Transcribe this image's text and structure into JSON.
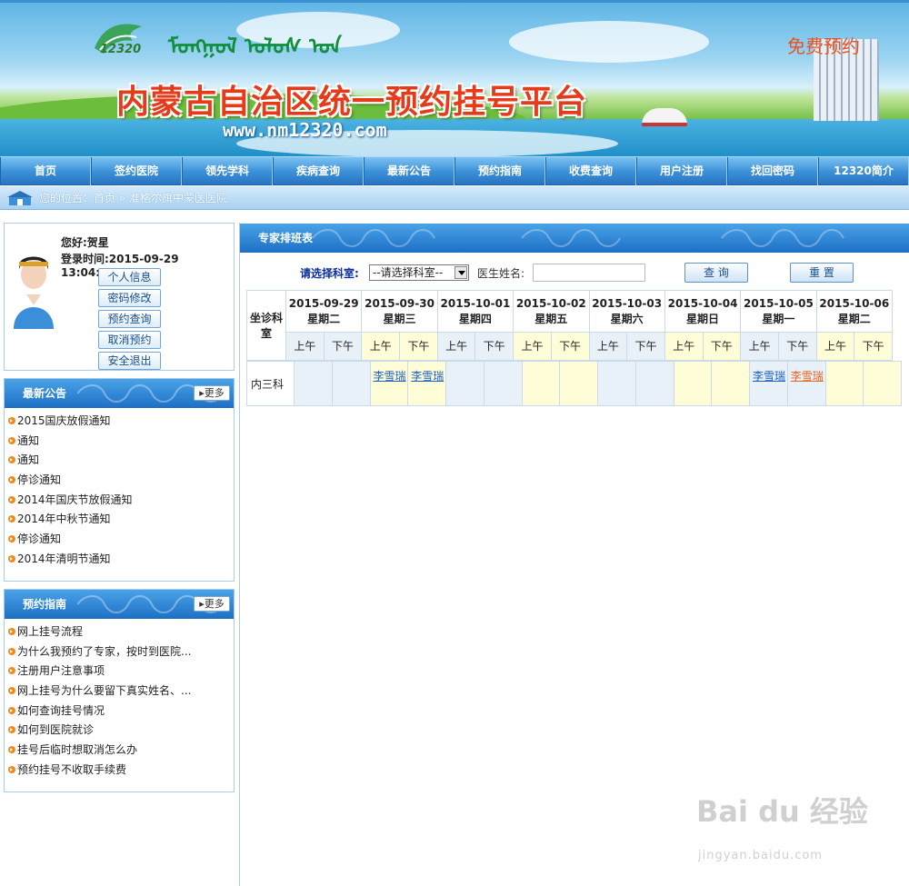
{
  "banner": {
    "title": "内蒙古自治区统一预约挂号平台",
    "badge": "12320",
    "url": "www.nm12320.com",
    "free_label": "免费预约"
  },
  "nav": [
    "首页",
    "签约医院",
    "领先学科",
    "疾病查询",
    "最新公告",
    "预约指南",
    "收费查询",
    "用户注册",
    "找回密码",
    "12320简介"
  ],
  "breadcrumb": {
    "prefix": "您的位置：",
    "home": "首页",
    "sep": "»",
    "current": "准格尔旗中蒙医医院"
  },
  "user": {
    "greeting": "您好:贺星",
    "login_time": "登录时间:2015-09-29 13:04:11",
    "buttons": [
      "个人信息",
      "密码修改",
      "预约查询",
      "取消预约",
      "安全退出"
    ]
  },
  "notices": {
    "title": "最新公告",
    "more": "更多",
    "items": [
      "2015国庆放假通知",
      "通知",
      "通知",
      "停诊通知",
      "2014年国庆节放假通知",
      "2014年中秋节通知",
      "停诊通知",
      "2014年清明节通知"
    ]
  },
  "guide": {
    "title": "预约指南",
    "more": "更多",
    "items": [
      "网上挂号流程",
      "为什么我预约了专家，按时到医院...",
      "注册用户注意事项",
      "网上挂号为什么要留下真实姓名、...",
      "如何查询挂号情况",
      "如何到医院就诊",
      "挂号后临时想取消怎么办",
      "预约挂号不收取手续费"
    ]
  },
  "schedule": {
    "title": "专家排班表",
    "dept_label": "请选择科室:",
    "dept_selected": "--请选择科室--",
    "doctor_label": "医生姓名:",
    "doctor_value": "",
    "search_button": "查 询",
    "reset_button": "重 置",
    "corner": "坐诊科室",
    "days": [
      {
        "date": "2015-09-29",
        "weekday": "星期二",
        "color": "blue"
      },
      {
        "date": "2015-09-30",
        "weekday": "星期三",
        "color": "yellow"
      },
      {
        "date": "2015-10-01",
        "weekday": "星期四",
        "color": "blue"
      },
      {
        "date": "2015-10-02",
        "weekday": "星期五",
        "color": "yellow"
      },
      {
        "date": "2015-10-03",
        "weekday": "星期六",
        "color": "blue"
      },
      {
        "date": "2015-10-04",
        "weekday": "星期日",
        "color": "yellow"
      },
      {
        "date": "2015-10-05",
        "weekday": "星期一",
        "color": "blue"
      },
      {
        "date": "2015-10-06",
        "weekday": "星期二",
        "color": "yellow"
      }
    ],
    "am": "上午",
    "pm": "下午",
    "rows": [
      {
        "dept": "内三科",
        "slots": [
          "",
          "",
          "李雪瑞",
          "李雪瑞",
          "",
          "",
          "",
          "",
          "",
          "",
          "",
          "",
          "李雪瑞",
          "李雪瑞",
          "",
          ""
        ],
        "slot_colors": [
          "",
          "",
          "blue",
          "blue",
          "",
          "",
          "",
          "",
          "",
          "",
          "",
          "",
          "blue",
          "orange",
          "",
          ""
        ]
      }
    ]
  },
  "watermark": {
    "main": "Bai du 经验",
    "sub": "jingyan.baidu.com"
  }
}
